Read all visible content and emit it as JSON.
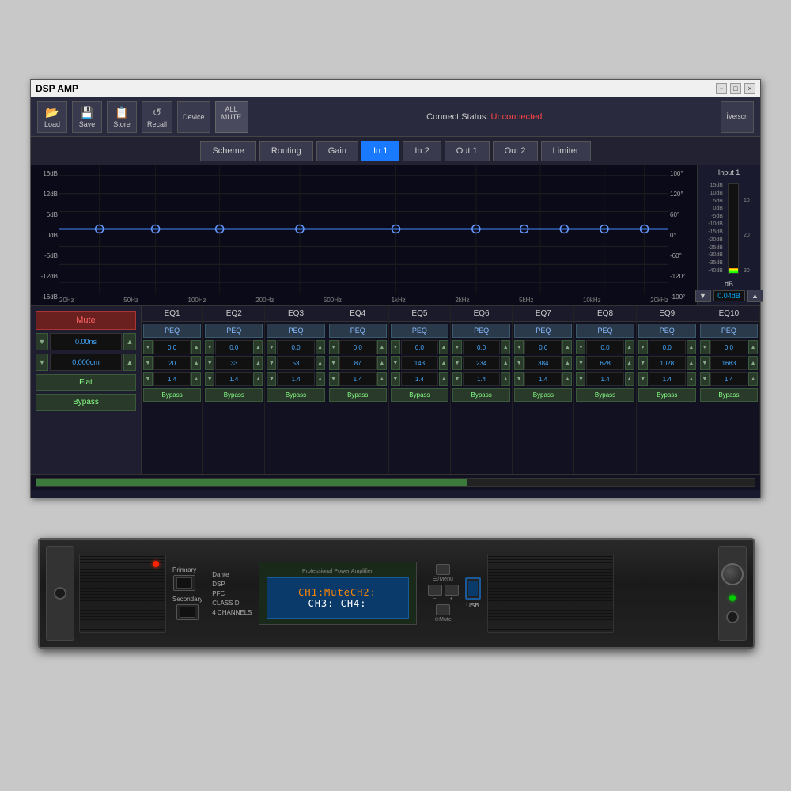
{
  "window": {
    "title": "DSP AMP",
    "controls": [
      "−",
      "□",
      "×"
    ]
  },
  "toolbar": {
    "buttons": [
      {
        "id": "load",
        "label": "Load",
        "icon": "📂"
      },
      {
        "id": "save",
        "label": "Save",
        "icon": "💾"
      },
      {
        "id": "store",
        "label": "Store",
        "icon": "📋"
      },
      {
        "id": "recall",
        "label": "Recall",
        "icon": "↺"
      }
    ],
    "device_label": "Device",
    "all_mute_label": "ALL\nMUTE",
    "connect_status_label": "Connect Status:",
    "connect_status_value": "Unconnected",
    "version_label": "i\nVerson"
  },
  "tabs": [
    {
      "id": "scheme",
      "label": "Scheme",
      "active": false
    },
    {
      "id": "routing",
      "label": "Routing",
      "active": false
    },
    {
      "id": "gain",
      "label": "Gain",
      "active": false
    },
    {
      "id": "in1",
      "label": "In 1",
      "active": true
    },
    {
      "id": "in2",
      "label": "In 2",
      "active": false
    },
    {
      "id": "out1",
      "label": "Out 1",
      "active": false
    },
    {
      "id": "out2",
      "label": "Out 2",
      "active": false
    },
    {
      "id": "limiter",
      "label": "Limiter",
      "active": false
    }
  ],
  "eq_graph": {
    "db_labels_left": [
      "16dB",
      "12dB",
      "6dB",
      "0dB",
      "-6dB",
      "-12dB",
      "-16dB"
    ],
    "degree_labels_right": [
      "100°",
      "120°",
      "60°",
      "0°",
      "-60°",
      "-120°",
      "-100°"
    ],
    "freq_labels": [
      "20Hz",
      "50Hz",
      "100Hz",
      "200Hz",
      "500Hz",
      "1kHz",
      "2kHz",
      "5kHz",
      "10kHz",
      "20kHz"
    ]
  },
  "input_meter": {
    "label": "Input 1",
    "scale": [
      "15dB",
      "10dB",
      "5dB",
      "0dB",
      "-5dB",
      "-10dB",
      "-15dB",
      "-20dB",
      "-25dB",
      "-30dB",
      "-35dB",
      "-40dB"
    ],
    "right_scale": [
      "10",
      "20",
      "30"
    ],
    "value": "0.0dB",
    "down_btn": "▼",
    "up_btn": "▲",
    "db_value": "0.04dB"
  },
  "left_panel": {
    "mute_label": "Mute",
    "delay_value": "0.00ns",
    "gain_value": "0.000cm",
    "flat_label": "Flat",
    "bypass_label": "Bypass"
  },
  "eq_columns": [
    {
      "header": "EQ1",
      "type": "PEQ",
      "gain": "0.0",
      "freq": "20",
      "q": "1.4",
      "bypass": "Bypass"
    },
    {
      "header": "EQ2",
      "type": "PEQ",
      "gain": "0.0",
      "freq": "33",
      "q": "1.4",
      "bypass": "Bypass"
    },
    {
      "header": "EQ3",
      "type": "PEQ",
      "gain": "0.0",
      "freq": "53",
      "q": "1.4",
      "bypass": "Bypass"
    },
    {
      "header": "EQ4",
      "type": "PEQ",
      "gain": "0.0",
      "freq": "87",
      "q": "1.4",
      "bypass": "Bypass"
    },
    {
      "header": "EQ5",
      "type": "PEQ",
      "gain": "0.0",
      "freq": "143",
      "q": "1.4",
      "bypass": "Bypass"
    },
    {
      "header": "EQ6",
      "type": "PEQ",
      "gain": "0.0",
      "freq": "234",
      "q": "1.4",
      "bypass": "Bypass"
    },
    {
      "header": "EQ7",
      "type": "PEQ",
      "gain": "0.0",
      "freq": "384",
      "q": "1.4",
      "bypass": "Bypass"
    },
    {
      "header": "EQ8",
      "type": "PEQ",
      "gain": "0.0",
      "freq": "628",
      "q": "1.4",
      "bypass": "Bypass"
    },
    {
      "header": "EQ9",
      "type": "PEQ",
      "gain": "0.0",
      "freq": "1028",
      "q": "1.4",
      "bypass": "Bypass"
    },
    {
      "header": "EQ10",
      "type": "PEQ",
      "gain": "0.0",
      "freq": "1683",
      "q": "1.4",
      "bypass": "Bypass"
    }
  ],
  "hardware": {
    "title": "Professional Power Amplifier",
    "display_lines": [
      "CH1:MuteCH2:",
      "CH3:    CH4:"
    ],
    "features": [
      "Dante",
      "DSP",
      "PFC",
      "CLASS D",
      "4 CHANNELS"
    ],
    "network_labels": [
      "Primrary",
      "Secondary"
    ],
    "control_labels": [
      "☰/Menu",
      "−",
      "+",
      "⊙Mute"
    ],
    "usb_label": "USB"
  }
}
